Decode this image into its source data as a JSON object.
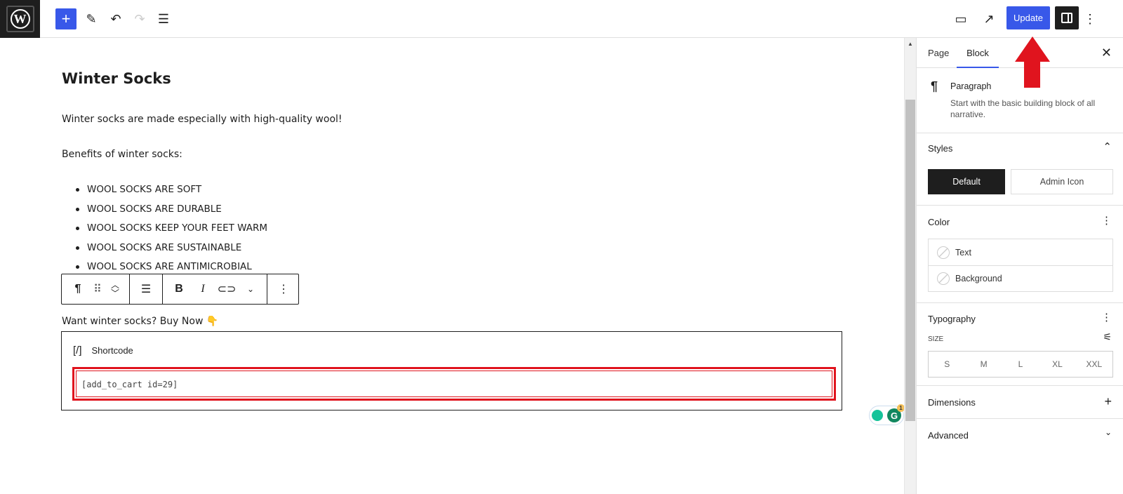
{
  "topbar": {
    "logo": "W",
    "add_icon": "+",
    "update_label": "Update",
    "icons": [
      "plus-icon",
      "pencil-icon",
      "undo-icon",
      "redo-icon",
      "list-view-icon",
      "desktop-preview-icon",
      "external-link-icon",
      "sidebar-toggle-icon",
      "more-vertical-icon"
    ]
  },
  "content": {
    "heading": "Winter Socks",
    "intro": "Winter socks are made especially with high-quality wool!",
    "benefits_label": "Benefits of winter socks:",
    "benefits": [
      "WOOL SOCKS ARE SOFT",
      "WOOL SOCKS ARE DURABLE",
      "WOOL SOCKS KEEP YOUR FEET WARM",
      "WOOL SOCKS ARE SUSTAINABLE",
      "WOOL SOCKS ARE ANTIMICROBIAL"
    ],
    "cta": "Want winter socks? Buy Now 👇",
    "shortcode": {
      "icon": "[/]",
      "label": "Shortcode",
      "value": "[add_to_cart id=29]"
    }
  },
  "block_toolbar": {
    "paragraph": "¶",
    "bold": "B",
    "italic": "I"
  },
  "grammarly": {
    "badge": "1"
  },
  "sidebar": {
    "tabs": [
      "Page",
      "Block"
    ],
    "active_tab": "Block",
    "block": {
      "icon": "¶",
      "name": "Paragraph",
      "description": "Start with the basic building block of all narrative."
    },
    "styles": {
      "title": "Styles",
      "options": [
        "Default",
        "Admin Icon"
      ],
      "selected": "Default"
    },
    "color": {
      "title": "Color",
      "items": [
        "Text",
        "Background"
      ]
    },
    "typography": {
      "title": "Typography",
      "size_label": "SIZE",
      "sizes": [
        "S",
        "M",
        "L",
        "XL",
        "XXL"
      ]
    },
    "dimensions": {
      "title": "Dimensions"
    },
    "advanced": {
      "title": "Advanced"
    }
  },
  "colors": {
    "accent": "#3858e9",
    "annotation": "#e0141e",
    "dark": "#1e1e1e"
  }
}
